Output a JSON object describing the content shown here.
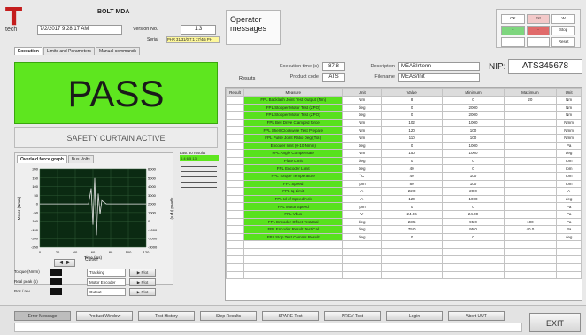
{
  "header": {
    "logo_text": "tech",
    "station": "BOLT MDA",
    "datetime": "7/2/2017 9:28:17 AM",
    "version_label": "Version No.",
    "version": "1.3",
    "serial_label": "Serial",
    "serial_value": "PHR 31/31/0 7:1 27/4/5 PH",
    "operator_messages_line1": "Operator",
    "operator_messages_line2": "messages"
  },
  "tabs": [
    "Execution",
    "Limits and Parameters",
    "Manual commands"
  ],
  "status": {
    "result": "PASS",
    "safety": "SAFETY CURTAIN ACTIVE",
    "result_color": "#5ee61f"
  },
  "info": {
    "execution_time_label": "Execution time (s)",
    "execution_time": "87.8",
    "product_code_label": "Product code",
    "product_code": "ATS",
    "results_label": "Results",
    "description_label": "Description",
    "description": "MEASInterm",
    "filename_label": "Filename",
    "filename": "MEAS/Init",
    "nip_label": "NIP:",
    "nip_value": "ATS345678"
  },
  "graph": {
    "tabs": [
      "Overlaid force graph",
      "Bus Volts"
    ],
    "legend_label": "Last 30 results",
    "legend_value": "0.4 6.5 13",
    "y_left": [
      "200",
      "150",
      "100",
      "50",
      "0",
      "-50",
      "-100",
      "-150",
      "-200",
      "-250"
    ],
    "y_right": [
      "6000",
      "5000",
      "4000",
      "3000",
      "2000",
      "1000",
      "0",
      "-1000",
      "-2000",
      "-3000"
    ],
    "y_left_title": "Motor (Nmm)",
    "y_right_title": "Speed (rpm)",
    "x_ticks": [
      "0",
      "20",
      "40",
      "60",
      "80",
      "100",
      "120"
    ],
    "x_title": "Time (ms)",
    "chart_data": {
      "type": "line",
      "xlim": [
        0,
        120
      ],
      "ylim": [
        -250,
        200
      ],
      "series": [
        {
          "x": [
            0,
            30,
            50,
            55,
            58,
            60,
            62,
            64,
            66,
            68,
            70,
            75,
            80,
            100,
            120
          ],
          "y": [
            0,
            0,
            0,
            0,
            90,
            -120,
            150,
            -180,
            60,
            -60,
            20,
            0,
            0,
            0,
            0
          ]
        }
      ]
    }
  },
  "graph_controls": {
    "cursor_label": "Cursor",
    "rows": [
      {
        "label": "Torque (Nmm)",
        "select": "Tracking"
      },
      {
        "label": "Real peak (s)",
        "select": "Motor Encoder"
      },
      {
        "label": "Pos / rev",
        "select": "Output"
      }
    ],
    "btn": "▶ Plot"
  },
  "table": {
    "headers": [
      "Result",
      "Measure",
      "Unit",
      "Value",
      "Minimum",
      "Maximum",
      "Unit"
    ],
    "rows": [
      [
        "",
        "FPL Backlash Joint Test Output (Nm)",
        "Nm",
        "8",
        "0",
        "20",
        "Nm"
      ],
      [
        "",
        "FPL Stopper Motor Test (ZPO)",
        "deg",
        "0",
        "2000",
        "",
        "Nm"
      ],
      [
        "",
        "FPL Stopper Motor Test (ZPO)",
        "deg",
        "0",
        "2000",
        "",
        "Nm"
      ],
      [
        "",
        "FPL Bell Drive Clamped force",
        "Nm",
        "102",
        "1000",
        "",
        "Nmm"
      ],
      [
        "",
        "FPL Shell Clockwise Test Prepare",
        "Nm",
        "120",
        "100",
        "",
        "Nmm"
      ],
      [
        "",
        "FPL Pulse Joint Ratio Deg (Tol.)",
        "Nm",
        "110",
        "100",
        "",
        "Nmm"
      ],
      [
        "",
        "Encoder limit (0-10 Nmm)",
        "deg",
        "0",
        "1000",
        "",
        "Pa"
      ],
      [
        "",
        "FPL Angle Compensate",
        "Nm",
        "150",
        "1000",
        "",
        "deg"
      ],
      [
        "",
        "Plate Limit",
        "deg",
        "0",
        "0",
        "",
        "rpm"
      ],
      [
        "",
        "FPL Encoder Limit",
        "deg",
        "40",
        "0",
        "",
        "rpm"
      ],
      [
        "",
        "FPL Torque Temperature",
        "°C",
        "40",
        "100",
        "",
        "rpm"
      ],
      [
        "",
        "FPL Speed",
        "rpm",
        "80",
        "100",
        "",
        "rpm"
      ],
      [
        "",
        "FPL Iq Limit",
        "A",
        "22.0",
        "20.0",
        "",
        "A"
      ],
      [
        "",
        "FPL Id of Speed/Ack",
        "A",
        "120",
        "1000",
        "",
        "deg"
      ],
      [
        "",
        "FPL Motor Speed",
        "rpm",
        "0",
        "0",
        "",
        "Pa"
      ],
      [
        "",
        "FPL Vbus",
        "V",
        "24.06",
        "24.00",
        "",
        "Pa"
      ],
      [
        "",
        "FPL Encoder Offset Test/Cal",
        "deg",
        "23.5",
        "95.0",
        "100",
        "Pa"
      ],
      [
        "",
        "FPL Encoder Result Test/Cal",
        "deg",
        "75.0",
        "95.0",
        "40.0",
        "Pa"
      ],
      [
        "",
        "FPL Stop Test Comms Result",
        "deg",
        "0",
        "0",
        "",
        "deg"
      ],
      [
        "",
        "",
        "",
        "",
        "",
        "",
        ""
      ],
      [
        "",
        "",
        "",
        "",
        "",
        "",
        ""
      ],
      [
        "",
        "",
        "",
        "",
        "",
        "",
        ""
      ],
      [
        "",
        "",
        "",
        "",
        "",
        "",
        ""
      ],
      [
        "",
        "",
        "",
        "",
        "",
        "",
        ""
      ]
    ],
    "name_rows": 19
  },
  "bottom_bar": {
    "buttons": [
      "Error Message",
      "Product Window",
      "Test History",
      "Step Results",
      "SPARE Test",
      "PREV Test",
      "Login",
      "Abort UUT"
    ],
    "exit": "EXIT"
  },
  "indicator": {
    "rows": [
      [
        "OK",
        "Err",
        "W"
      ],
      [
        "+",
        "-",
        "Stop"
      ],
      [
        "",
        "",
        "Reset"
      ]
    ],
    "colors": {
      "ok": "#7ed67e",
      "err": "#e06a6a"
    }
  }
}
